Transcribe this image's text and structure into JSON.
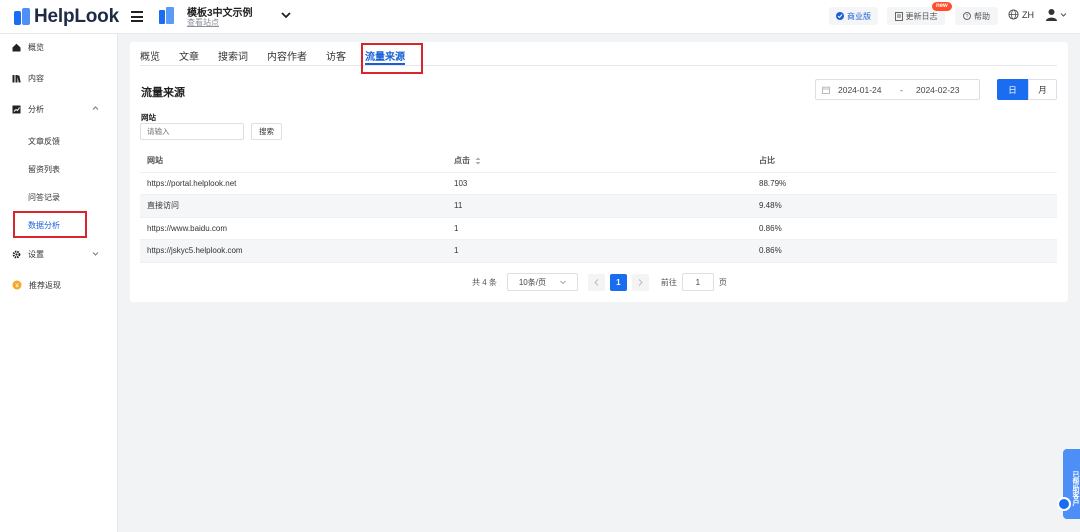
{
  "header": {
    "logo_text": "HelpLook",
    "site_name": "模板3中文示例",
    "site_link": "查看站点",
    "business_label": "商业版",
    "update_label": "更新日志",
    "new_badge": "new",
    "help_label": "帮助",
    "lang_label": "ZH"
  },
  "sidebar": {
    "items": [
      {
        "label": "概览",
        "icon": "home-icon"
      },
      {
        "label": "内容",
        "icon": "library-icon"
      },
      {
        "label": "分析",
        "icon": "chart-icon"
      },
      {
        "label": "设置",
        "icon": "gear-icon"
      },
      {
        "label": "推荐返现",
        "icon": "coin-icon"
      }
    ],
    "sub_items": [
      "文章反馈",
      "留资列表",
      "问答记录",
      "数据分析"
    ]
  },
  "tabs": [
    "概览",
    "文章",
    "搜索词",
    "内容作者",
    "访客",
    "流量来源"
  ],
  "section_title": "流量来源",
  "date_range": {
    "start": "2024-01-24",
    "separator": "-",
    "end": "2024-02-23"
  },
  "period_toggle": {
    "day": "日",
    "month": "月"
  },
  "filter": {
    "label": "网站",
    "placeholder": "请输入",
    "search_label": "搜索"
  },
  "table": {
    "headers": [
      "网站",
      "点击",
      "占比"
    ],
    "rows": [
      {
        "site": "https://portal.helplook.net",
        "clicks": "103",
        "ratio": "88.79%"
      },
      {
        "site": "直接访问",
        "clicks": "11",
        "ratio": "9.48%"
      },
      {
        "site": "https://www.baidu.com",
        "clicks": "1",
        "ratio": "0.86%"
      },
      {
        "site": "https://jskyc5.helplook.com",
        "clicks": "1",
        "ratio": "0.86%"
      }
    ]
  },
  "pagination": {
    "total": "共 4 条",
    "page_size": "10条/页",
    "current": "1",
    "goto_label": "前往",
    "goto_value": "1",
    "page_unit": "页"
  },
  "float_tab": "已帮助客户",
  "colors": {
    "accent": "#1a6cf0",
    "highlight": "#d9252c"
  }
}
